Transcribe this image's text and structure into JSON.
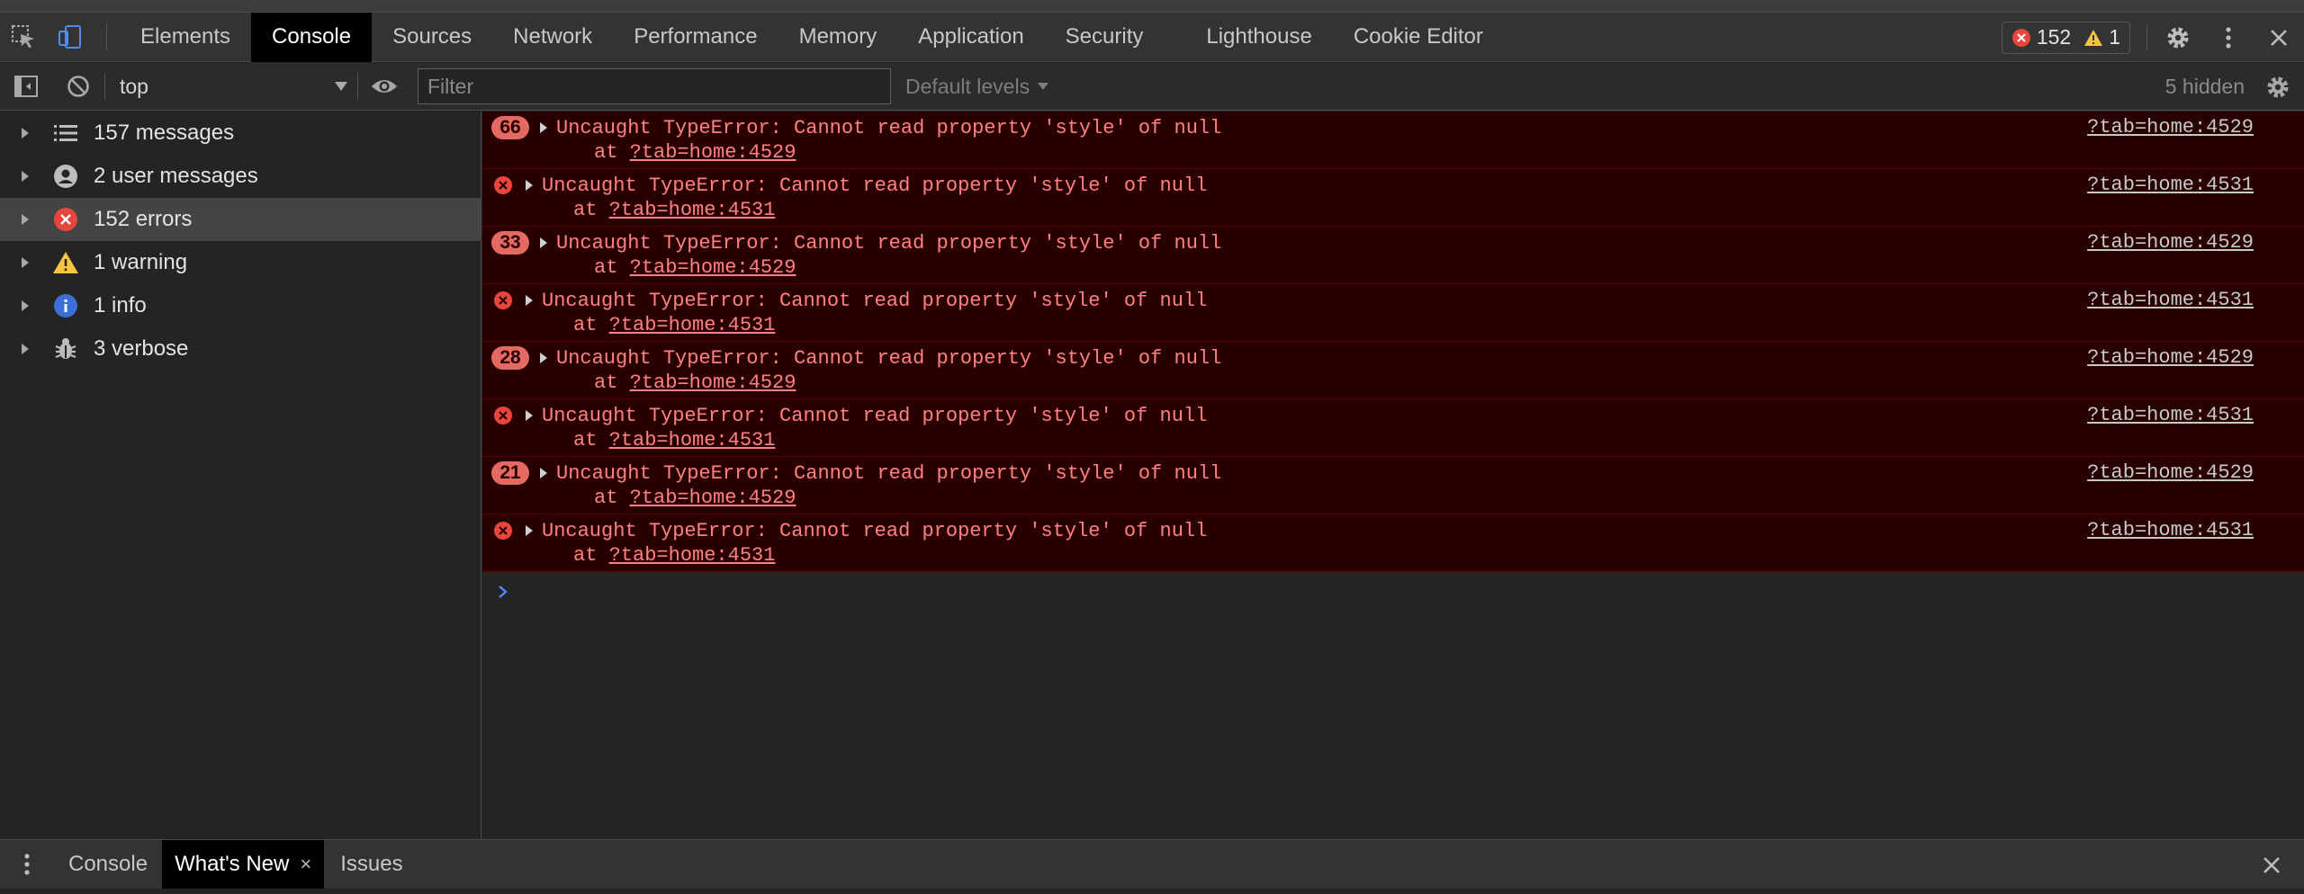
{
  "tabs": [
    "Elements",
    "Console",
    "Sources",
    "Network",
    "Performance",
    "Memory",
    "Application",
    "Security",
    "Lighthouse",
    "Cookie Editor"
  ],
  "counts": {
    "errors": "152",
    "warnings": "1"
  },
  "toolbar": {
    "context": "top",
    "filter_placeholder": "Filter",
    "levels": "Default levels",
    "hidden": "5 hidden"
  },
  "sidebar": {
    "items": [
      {
        "label": "157 messages",
        "icon": "list-icon"
      },
      {
        "label": "2 user messages",
        "icon": "user-icon"
      },
      {
        "label": "152 errors",
        "icon": "error-icon"
      },
      {
        "label": "1 warning",
        "icon": "warning-icon"
      },
      {
        "label": "1 info",
        "icon": "info-icon"
      },
      {
        "label": "3 verbose",
        "icon": "bug-icon"
      }
    ]
  },
  "messages": [
    {
      "badge": "66",
      "text": "Uncaught TypeError: Cannot read property 'style' of null",
      "at_prefix": "at ",
      "at_link": "?tab=home:4529",
      "source": "?tab=home:4529"
    },
    {
      "badge": "",
      "text": "Uncaught TypeError: Cannot read property 'style' of null",
      "at_prefix": "at ",
      "at_link": "?tab=home:4531",
      "source": "?tab=home:4531"
    },
    {
      "badge": "33",
      "text": "Uncaught TypeError: Cannot read property 'style' of null",
      "at_prefix": "at ",
      "at_link": "?tab=home:4529",
      "source": "?tab=home:4529"
    },
    {
      "badge": "",
      "text": "Uncaught TypeError: Cannot read property 'style' of null",
      "at_prefix": "at ",
      "at_link": "?tab=home:4531",
      "source": "?tab=home:4531"
    },
    {
      "badge": "28",
      "text": "Uncaught TypeError: Cannot read property 'style' of null",
      "at_prefix": "at ",
      "at_link": "?tab=home:4529",
      "source": "?tab=home:4529"
    },
    {
      "badge": "",
      "text": "Uncaught TypeError: Cannot read property 'style' of null",
      "at_prefix": "at ",
      "at_link": "?tab=home:4531",
      "source": "?tab=home:4531"
    },
    {
      "badge": "21",
      "text": "Uncaught TypeError: Cannot read property 'style' of null",
      "at_prefix": "at ",
      "at_link": "?tab=home:4529",
      "source": "?tab=home:4529"
    },
    {
      "badge": "",
      "text": "Uncaught TypeError: Cannot read property 'style' of null",
      "at_prefix": "at ",
      "at_link": "?tab=home:4531",
      "source": "?tab=home:4531"
    }
  ],
  "drawer": {
    "tabs": [
      "Console",
      "What's New",
      "Issues"
    ],
    "close_glyph": "×"
  },
  "colors": {
    "accent": "#4d8ef5",
    "error_bg": "#290000",
    "error_text": "#ff8080",
    "warning": "#f5c542"
  }
}
